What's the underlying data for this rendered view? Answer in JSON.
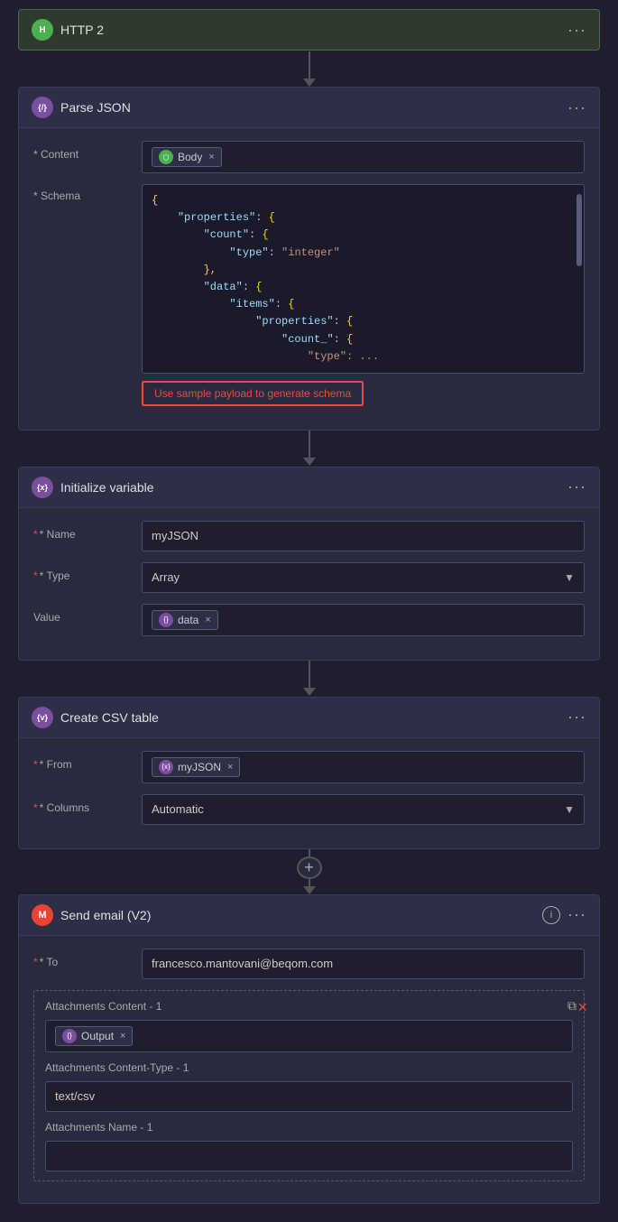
{
  "http2": {
    "title": "HTTP 2",
    "icon": "H",
    "icon_class": "icon-green"
  },
  "parse_json": {
    "title": "Parse JSON",
    "icon": "{}",
    "icon_class": "icon-purple",
    "content_label": "* Content",
    "content_chip": "Body",
    "schema_label": "* Schema",
    "schema_lines": [
      "{",
      "    \"properties\": {",
      "        \"count\": {",
      "            \"type\": \"integer\"",
      "        },",
      "        \"data\": {",
      "            \"items\": {",
      "                \"properties\": {",
      "                    \"count_\": {"
    ],
    "generate_btn": "Use sample payload to generate schema"
  },
  "initialize_variable": {
    "title": "Initialize variable",
    "icon": "{x}",
    "icon_class": "icon-purple",
    "name_label": "* Name",
    "name_value": "myJSON",
    "type_label": "* Type",
    "type_value": "Array",
    "value_label": "Value",
    "value_chip": "data"
  },
  "create_csv": {
    "title": "Create CSV table",
    "icon": "{v}",
    "icon_class": "icon-purple",
    "from_label": "* From",
    "from_chip": "myJSON",
    "columns_label": "* Columns",
    "columns_value": "Automatic"
  },
  "send_email": {
    "title": "Send email (V2)",
    "icon": "M",
    "icon_class": "icon-gmail",
    "to_label": "* To",
    "to_value": "francesco.mantovani@beqom.com",
    "attachments_content_label": "Attachments Content - 1",
    "output_chip": "Output",
    "attachments_type_label": "Attachments Content-Type - 1",
    "attachments_type_value": "text/csv",
    "attachments_name_label": "Attachments Name - 1"
  },
  "icons": {
    "body_chip_color": "#4caf50",
    "data_chip_color": "#7b4fa0",
    "myjson_chip_color": "#7b4fa0",
    "output_chip_color": "#7b4fa0"
  }
}
